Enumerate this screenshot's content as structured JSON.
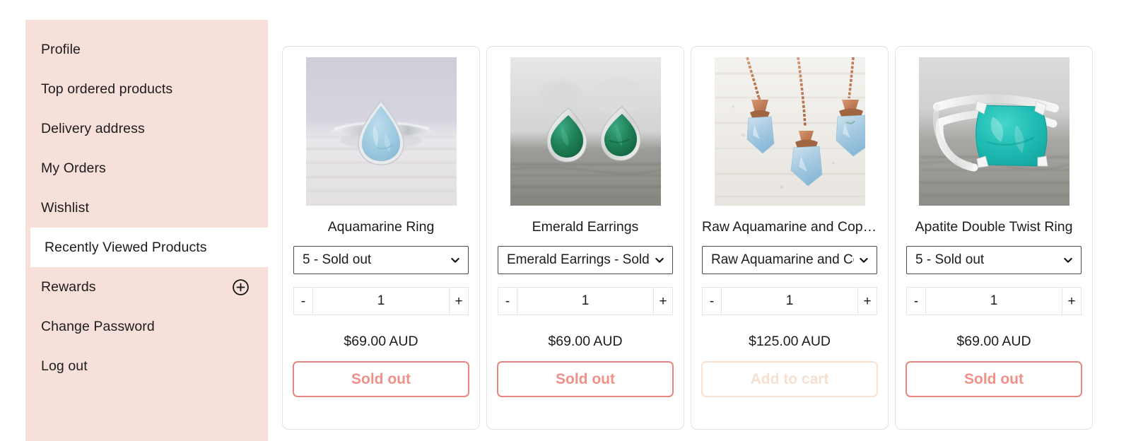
{
  "theme": {
    "sidebar_bg": "#f7dfda",
    "active_bg": "#ffffff",
    "card_border": "#e2e2e2",
    "soldout_border": "#e6867e",
    "soldout_text": "#ef9189",
    "disabled_border": "#f7e3d4",
    "disabled_text": "#f6e0d1",
    "text": "#1c1c1c"
  },
  "sidebar": {
    "items": [
      {
        "label": "Profile",
        "active": false,
        "icon": null
      },
      {
        "label": "Top ordered products",
        "active": false,
        "icon": null
      },
      {
        "label": "Delivery address",
        "active": false,
        "icon": null
      },
      {
        "label": "My Orders",
        "active": false,
        "icon": null
      },
      {
        "label": "Wishlist",
        "active": false,
        "icon": null
      },
      {
        "label": "Recently Viewed Products",
        "active": true,
        "icon": null
      },
      {
        "label": "Rewards",
        "active": false,
        "icon": "plus-circle-icon"
      },
      {
        "label": "Change Password",
        "active": false,
        "icon": null
      },
      {
        "label": "Log out",
        "active": false,
        "icon": null
      }
    ]
  },
  "products": [
    {
      "title": "Aquamarine Ring",
      "image_alt": "aquamarine-pear-ring-photo",
      "variant_selected": "5 - Sold out",
      "quantity": "1",
      "decrement_label": "-",
      "increment_label": "+",
      "price": "$69.00 AUD",
      "cta_label": "Sold out",
      "cta_state": "soldout"
    },
    {
      "title": "Emerald Earrings",
      "image_alt": "emerald-stud-earrings-photo",
      "variant_selected": "Emerald Earrings - Sold out",
      "quantity": "1",
      "decrement_label": "-",
      "increment_label": "+",
      "price": "$69.00 AUD",
      "cta_label": "Sold out",
      "cta_state": "soldout"
    },
    {
      "title": "Raw Aquamarine and Copper Necklace",
      "image_alt": "raw-aquamarine-copper-necklaces-photo",
      "variant_selected": "Raw Aquamarine and Copper Necklace",
      "quantity": "1",
      "decrement_label": "-",
      "increment_label": "+",
      "price": "$125.00 AUD",
      "cta_label": "Add to cart",
      "cta_state": "disabled"
    },
    {
      "title": "Apatite Double Twist Ring",
      "image_alt": "apatite-double-twist-ring-photo",
      "variant_selected": "5 - Sold out",
      "quantity": "1",
      "decrement_label": "-",
      "increment_label": "+",
      "price": "$69.00 AUD",
      "cta_label": "Sold out",
      "cta_state": "soldout"
    }
  ]
}
